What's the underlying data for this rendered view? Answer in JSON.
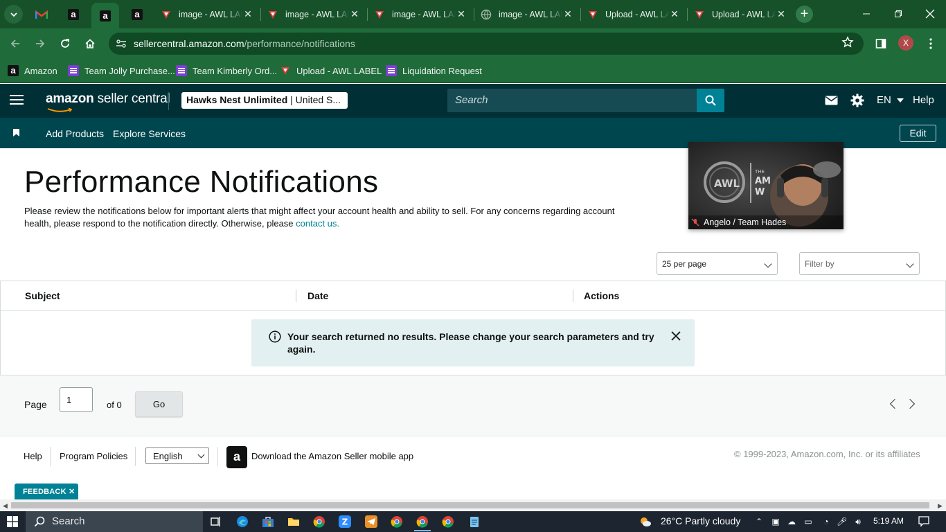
{
  "browser": {
    "tabs": [
      {
        "title": "image - AWL LABEL"
      },
      {
        "title": "image - AWL LABEL"
      },
      {
        "title": "image - AWL LABEL"
      },
      {
        "title": "image - AWL LABEL"
      },
      {
        "title": "Upload - AWL LABEL"
      },
      {
        "title": "Upload - AWL LABEL"
      }
    ],
    "close_glyph": "✕",
    "new_tab_glyph": "+",
    "url_host": "sellercentral.amazon.com",
    "url_path": "/performance/notifications",
    "profile_initial": "X",
    "bookmarks": [
      {
        "label": "Amazon",
        "icon": "amazon-icon"
      },
      {
        "label": "Team Jolly Purchase...",
        "icon": "list-icon"
      },
      {
        "label": "Team Kimberly Ord...",
        "icon": "list-icon"
      },
      {
        "label": "Upload - AWL LABEL",
        "icon": "awl-icon"
      },
      {
        "label": "Liquidation Request",
        "icon": "list-icon"
      }
    ]
  },
  "header": {
    "logo_text_bold": "amazon",
    "logo_text_rest": " seller central",
    "store_name": "Hawks Nest Unlimited",
    "store_region": " | United S...",
    "search_placeholder": "Search",
    "language": "EN",
    "help": "Help",
    "colors": {
      "bar": "#002f36",
      "subnav": "#00464f",
      "accent": "#008296"
    }
  },
  "subnav": {
    "links": [
      "Add Products",
      "Explore Services"
    ],
    "edit_label": "Edit"
  },
  "main": {
    "title": "Performance Notifications",
    "description": "Please review the notifications below for important alerts that might affect your account health and ability to sell. For any concerns regarding account health, please respond to the notification directly. Otherwise, please ",
    "contact_link": "contact us.",
    "per_page": "25 per page",
    "filter_placeholder": "Filter by",
    "columns": [
      "Subject",
      "Date",
      "Actions"
    ],
    "alert_text": "Your search returned no results. Please change your search parameters and try again."
  },
  "pager": {
    "page_label": "Page",
    "page_value": "1",
    "of_label": "of 0",
    "go_label": "Go"
  },
  "footer": {
    "help": "Help",
    "program_policies": "Program Policies",
    "language": "English",
    "app_text": "Download the Amazon Seller mobile app",
    "copyright": "© 1999-2023, Amazon.com, Inc. or its affiliates",
    "feedback": "FEEDBACK ✕"
  },
  "video": {
    "name": "Angelo / Team Hades",
    "logo_text": "AWL"
  },
  "taskbar": {
    "search": "Search",
    "weather": "26°C  Partly cloudy",
    "time": "5:19 AM"
  }
}
